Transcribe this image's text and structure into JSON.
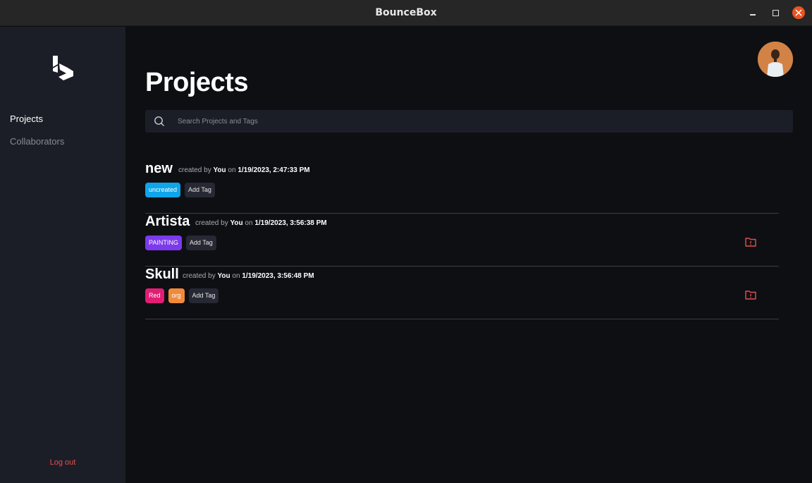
{
  "window": {
    "title": "BounceBox"
  },
  "sidebar": {
    "items": [
      {
        "label": "Projects",
        "active": true
      },
      {
        "label": "Collaborators",
        "active": false
      }
    ],
    "logout_label": "Log out"
  },
  "main": {
    "title": "Projects",
    "search": {
      "placeholder": "Search Projects and Tags",
      "value": ""
    },
    "projects": [
      {
        "name": "new",
        "created_by_label": "created by",
        "author": "You",
        "on_label": "on",
        "date": "1/19/2023, 2:47:33 PM",
        "tags": [
          {
            "label": "uncreated",
            "color": "#0ea5e9"
          }
        ],
        "add_tag_label": "Add Tag",
        "has_warning_icon": false
      },
      {
        "name": "Artista",
        "created_by_label": "created by",
        "author": "You",
        "on_label": "on",
        "date": "1/19/2023, 3:56:38 PM",
        "tags": [
          {
            "label": "PAINTING",
            "color": "#7c3aed"
          }
        ],
        "add_tag_label": "Add Tag",
        "has_warning_icon": true
      },
      {
        "name": "Skull",
        "created_by_label": "created by",
        "author": "You",
        "on_label": "on",
        "date": "1/19/2023, 3:56:48 PM",
        "tags": [
          {
            "label": "Red",
            "color": "#e11d74"
          },
          {
            "label": "org",
            "color": "#f08a3b"
          }
        ],
        "add_tag_label": "Add Tag",
        "has_warning_icon": true
      }
    ]
  },
  "colors": {
    "sidebar_bg": "#1c1e27",
    "main_bg": "#0e0f13",
    "logout": "#e2504f",
    "warning_icon": "#e2504f"
  },
  "icons": [
    "logo-icon",
    "search-icon",
    "folder-warning-icon",
    "close-icon",
    "minimize-icon",
    "maximize-icon"
  ]
}
